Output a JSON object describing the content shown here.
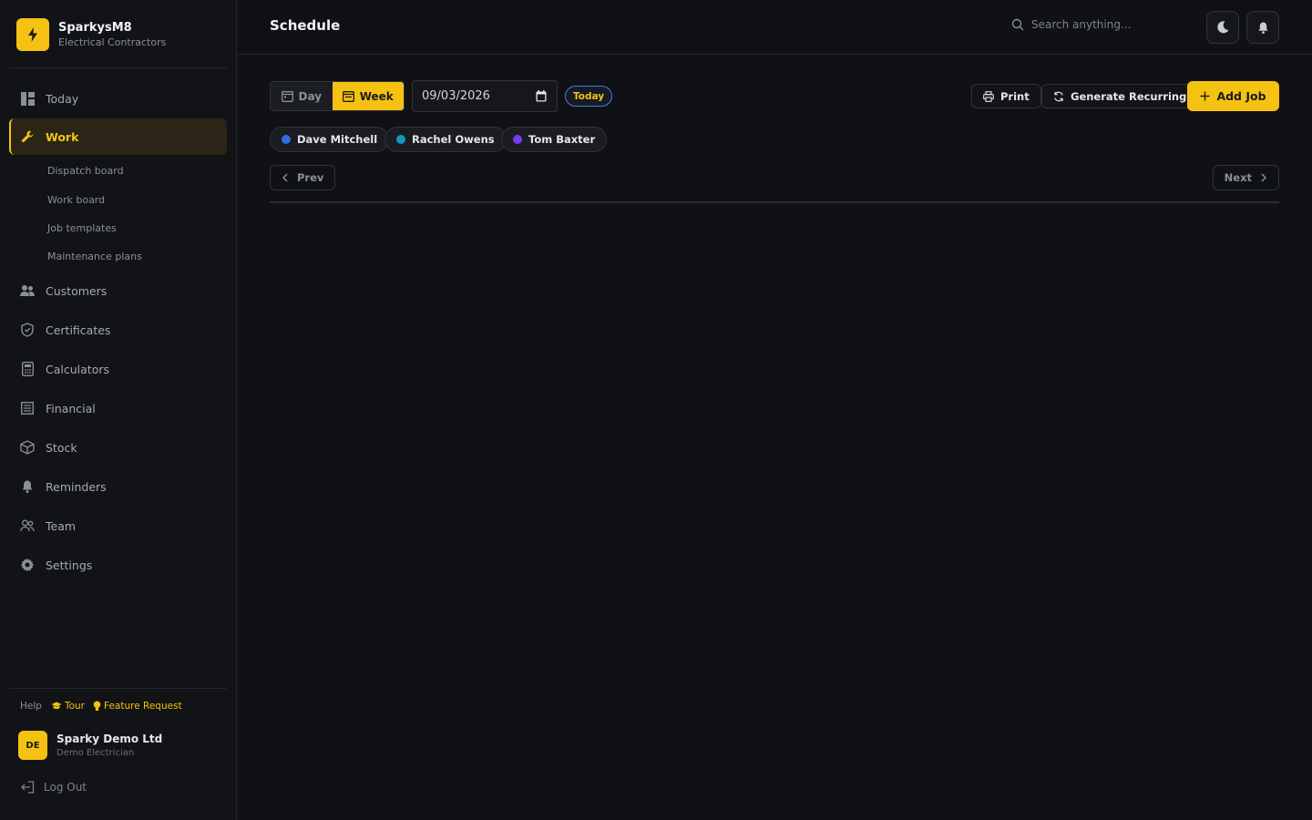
{
  "brand": {
    "name": "SparkysM8",
    "subtitle": "Electrical Contractors",
    "logo_icon": "lightning-bolt-icon",
    "accent": "#f5c211"
  },
  "sidebar": {
    "items": [
      {
        "label": "Today",
        "icon": "dashboard-icon"
      },
      {
        "label": "Work",
        "icon": "wrench-icon",
        "active": true
      },
      {
        "label": "Customers",
        "icon": "users-icon"
      },
      {
        "label": "Certificates",
        "icon": "shield-icon"
      },
      {
        "label": "Calculators",
        "icon": "calculator-icon"
      },
      {
        "label": "Financial",
        "icon": "ledger-icon"
      },
      {
        "label": "Stock",
        "icon": "box-icon"
      },
      {
        "label": "Reminders",
        "icon": "bell-icon"
      },
      {
        "label": "Team",
        "icon": "team-icon"
      },
      {
        "label": "Settings",
        "icon": "gear-icon"
      }
    ],
    "work_subitems": [
      "Dispatch board",
      "Work board",
      "Job templates",
      "Maintenance plans"
    ],
    "help_label": "Help",
    "tour_label": "Tour",
    "feature_request_label": "Feature Request",
    "user": {
      "initials": "DE",
      "name": "Sparky Demo Ltd",
      "role": "Demo Electrician"
    },
    "logout_label": "Log Out"
  },
  "header": {
    "title": "Schedule",
    "search_placeholder": "Search anything..."
  },
  "toolbar": {
    "day_label": "Day",
    "week_label": "Week",
    "selected_view": "Week",
    "date_value": "09/03/2026",
    "today_label": "Today",
    "print_label": "Print",
    "generate_recurring_label": "Generate Recurring",
    "add_job_label": "Add Job"
  },
  "technicians": [
    {
      "name": "Dave Mitchell",
      "color": "#2f6fe4"
    },
    {
      "name": "Rachel Owens",
      "color": "#1497b8"
    },
    {
      "name": "Tom Baxter",
      "color": "#7c3aed"
    }
  ],
  "pager": {
    "prev_label": "Prev",
    "next_label": "Next"
  }
}
